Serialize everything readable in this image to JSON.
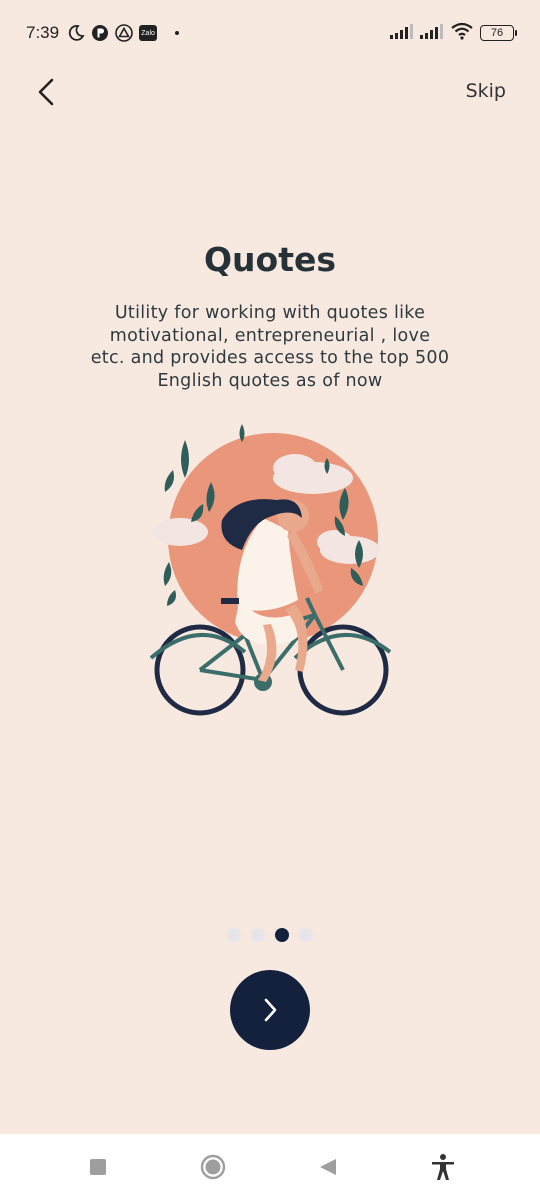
{
  "status_bar": {
    "time": "7:39",
    "zalo_label": "Zalo",
    "battery": "76",
    "icons": [
      "moon-icon",
      "p-badge-icon",
      "drive-icon",
      "zalo-icon",
      "signal-icon",
      "signal-icon",
      "wifi-icon",
      "battery-icon"
    ]
  },
  "header": {
    "back_icon": "chevron-left-icon",
    "skip_label": "Skip"
  },
  "slide": {
    "title": "Quotes",
    "description": "Utility for working with quotes like motivational, entrepreneurial , love etc. and provides access to the top 500 English quotes as of now",
    "illustration": "woman-riding-bicycle-illustration"
  },
  "pager": {
    "total": 4,
    "active_index": 2
  },
  "next_button": {
    "icon": "chevron-right-icon"
  },
  "nav_bar": {
    "items": [
      "recents-square-icon",
      "home-circle-icon",
      "back-triangle-icon",
      "accessibility-icon"
    ]
  },
  "colors": {
    "background": "#f7e9e0",
    "accent": "#14213d",
    "title": "#263238",
    "illustration_sun": "#e9967a"
  }
}
